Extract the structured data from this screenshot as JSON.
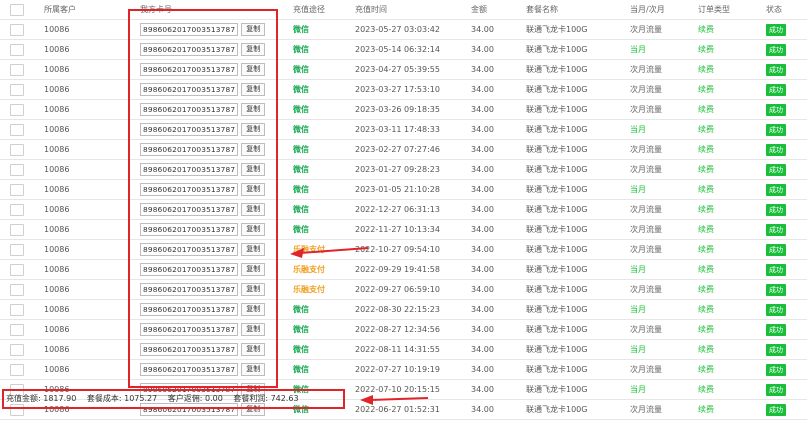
{
  "header": {
    "customer": "所属客户",
    "card": "我方卡号",
    "channel": "充值途径",
    "time": "充值时间",
    "amount": "金额",
    "plan": "套餐名称",
    "month": "当月/次月",
    "order_type": "订单类型",
    "status": "状态"
  },
  "copy_label": "复制",
  "rows": [
    {
      "customer": "10086",
      "card": "8986062017003513787",
      "channel": "微信",
      "time": "2023-05-27 03:03:42",
      "amount": "34.00",
      "plan": "联通飞龙卡100G",
      "month": "次月流量",
      "order_type": "续费",
      "status": "成功"
    },
    {
      "customer": "10086",
      "card": "8986062017003513787",
      "channel": "微信",
      "time": "2023-05-14 06:32:14",
      "amount": "34.00",
      "plan": "联通飞龙卡100G",
      "month": "当月",
      "order_type": "续费",
      "status": "成功"
    },
    {
      "customer": "10086",
      "card": "8986062017003513787",
      "channel": "微信",
      "time": "2023-04-27 05:39:55",
      "amount": "34.00",
      "plan": "联通飞龙卡100G",
      "month": "次月流量",
      "order_type": "续费",
      "status": "成功"
    },
    {
      "customer": "10086",
      "card": "8986062017003513787",
      "channel": "微信",
      "time": "2023-03-27 17:53:10",
      "amount": "34.00",
      "plan": "联通飞龙卡100G",
      "month": "次月流量",
      "order_type": "续费",
      "status": "成功"
    },
    {
      "customer": "10086",
      "card": "8986062017003513787",
      "channel": "微信",
      "time": "2023-03-26 09:18:35",
      "amount": "34.00",
      "plan": "联通飞龙卡100G",
      "month": "次月流量",
      "order_type": "续费",
      "status": "成功"
    },
    {
      "customer": "10086",
      "card": "8986062017003513787",
      "channel": "微信",
      "time": "2023-03-11 17:48:33",
      "amount": "34.00",
      "plan": "联通飞龙卡100G",
      "month": "当月",
      "order_type": "续费",
      "status": "成功"
    },
    {
      "customer": "10086",
      "card": "8986062017003513787",
      "channel": "微信",
      "time": "2023-02-27 07:27:46",
      "amount": "34.00",
      "plan": "联通飞龙卡100G",
      "month": "次月流量",
      "order_type": "续费",
      "status": "成功"
    },
    {
      "customer": "10086",
      "card": "8986062017003513787",
      "channel": "微信",
      "time": "2023-01-27 09:28:23",
      "amount": "34.00",
      "plan": "联通飞龙卡100G",
      "month": "次月流量",
      "order_type": "续费",
      "status": "成功"
    },
    {
      "customer": "10086",
      "card": "8986062017003513787",
      "channel": "微信",
      "time": "2023-01-05 21:10:28",
      "amount": "34.00",
      "plan": "联通飞龙卡100G",
      "month": "当月",
      "order_type": "续费",
      "status": "成功"
    },
    {
      "customer": "10086",
      "card": "8986062017003513787",
      "channel": "微信",
      "time": "2022-12-27 06:31:13",
      "amount": "34.00",
      "plan": "联通飞龙卡100G",
      "month": "次月流量",
      "order_type": "续费",
      "status": "成功"
    },
    {
      "customer": "10086",
      "card": "8986062017003513787",
      "channel": "微信",
      "time": "2022-11-27 10:13:34",
      "amount": "34.00",
      "plan": "联通飞龙卡100G",
      "month": "次月流量",
      "order_type": "续费",
      "status": "成功"
    },
    {
      "customer": "10086",
      "card": "8986062017003513787",
      "channel": "乐融支付",
      "time": "2022-10-27 09:54:10",
      "amount": "34.00",
      "plan": "联通飞龙卡100G",
      "month": "次月流量",
      "order_type": "续费",
      "status": "成功"
    },
    {
      "customer": "10086",
      "card": "8986062017003513787",
      "channel": "乐融支付",
      "time": "2022-09-29 19:41:58",
      "amount": "34.00",
      "plan": "联通飞龙卡100G",
      "month": "当月",
      "order_type": "续费",
      "status": "成功"
    },
    {
      "customer": "10086",
      "card": "8986062017003513787",
      "channel": "乐融支付",
      "time": "2022-09-27 06:59:10",
      "amount": "34.00",
      "plan": "联通飞龙卡100G",
      "month": "次月流量",
      "order_type": "续费",
      "status": "成功"
    },
    {
      "customer": "10086",
      "card": "8986062017003513787",
      "channel": "微信",
      "time": "2022-08-30 22:15:23",
      "amount": "34.00",
      "plan": "联通飞龙卡100G",
      "month": "当月",
      "order_type": "续费",
      "status": "成功"
    },
    {
      "customer": "10086",
      "card": "8986062017003513787",
      "channel": "微信",
      "time": "2022-08-27 12:34:56",
      "amount": "34.00",
      "plan": "联通飞龙卡100G",
      "month": "次月流量",
      "order_type": "续费",
      "status": "成功"
    },
    {
      "customer": "10086",
      "card": "8986062017003513787",
      "channel": "微信",
      "time": "2022-08-11 14:31:55",
      "amount": "34.00",
      "plan": "联通飞龙卡100G",
      "month": "当月",
      "order_type": "续费",
      "status": "成功"
    },
    {
      "customer": "10086",
      "card": "8986062017003513787",
      "channel": "微信",
      "time": "2022-07-27 10:19:19",
      "amount": "34.00",
      "plan": "联通飞龙卡100G",
      "month": "次月流量",
      "order_type": "续费",
      "status": "成功"
    },
    {
      "customer": "10086",
      "card": "8986062017003513787",
      "channel": "微信",
      "time": "2022-07-10 20:15:15",
      "amount": "34.00",
      "plan": "联通飞龙卡100G",
      "month": "当月",
      "order_type": "续费",
      "status": "成功"
    },
    {
      "customer": "10086",
      "card": "8986062017003513787",
      "channel": "微信",
      "time": "2022-06-27 01:52:31",
      "amount": "34.00",
      "plan": "联通飞龙卡100G",
      "month": "次月流量",
      "order_type": "续费",
      "status": "成功"
    }
  ],
  "summary": {
    "recharge": "充值金额: 1817.90",
    "cost": "套餐成本: 1075.27",
    "rebate": "客户返佣: 0.00",
    "profit": "套餐利润: 742.63"
  },
  "colors": {
    "wechat": "#1aaa55",
    "lerong": "#f0a020",
    "current_month": "#1ec03a",
    "success_badge": "#19be3b",
    "annotation": "#e0252a"
  }
}
